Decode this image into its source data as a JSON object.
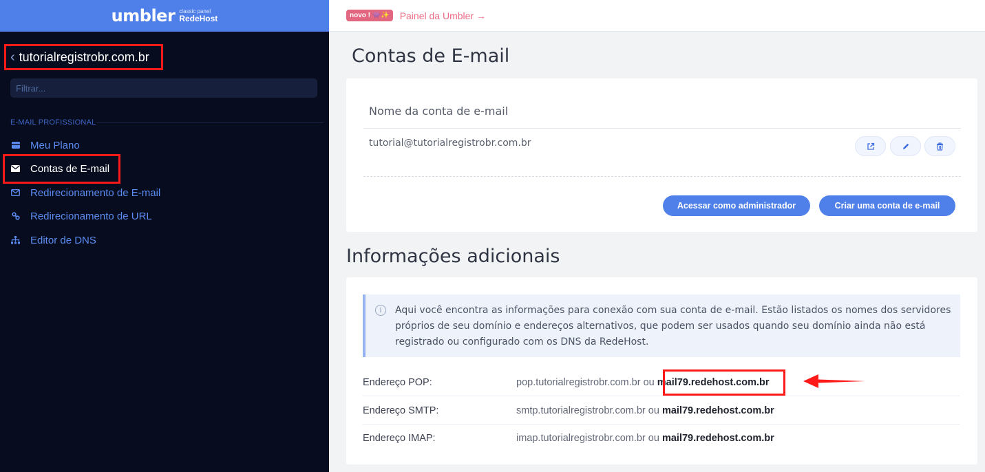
{
  "brand": {
    "logo": "umbler",
    "classic": "classic panel",
    "redehost": "RedeHost"
  },
  "sidebar": {
    "domain": "tutorialregistrobr.com.br",
    "filter_placeholder": "Filtrar...",
    "section_label": "E-MAIL PROFISSIONAL",
    "items": [
      {
        "label": "Meu Plano",
        "icon": "card-icon"
      },
      {
        "label": "Contas de E-mail",
        "icon": "envelope-icon",
        "active": true
      },
      {
        "label": "Redirecionamento de E-mail",
        "icon": "envelope-outline-icon"
      },
      {
        "label": "Redirecionamento de URL",
        "icon": "link-icon"
      },
      {
        "label": "Editor de DNS",
        "icon": "sitemap-icon"
      }
    ]
  },
  "topbar": {
    "badge": "novo ! 👾✨",
    "link": "Painel da Umbler →"
  },
  "main": {
    "title": "Contas de E-mail",
    "column_header": "Nome da conta de e-mail",
    "accounts": [
      {
        "address": "tutorial@tutorialregistrobr.com.br"
      }
    ],
    "buttons": {
      "admin": "Acessar como administrador",
      "create": "Criar uma conta de e-mail"
    }
  },
  "info": {
    "title": "Informações adicionais",
    "notice": "Aqui você encontra as informações para conexão com sua conta de e-mail. Estão listados os nomes dos servidores próprios de seu domínio e endereços alternativos, que podem ser usados quando seu domínio ainda não está registrado ou configurado com os DNS da RedeHost.",
    "rows": [
      {
        "label": "Endereço POP:",
        "value": "pop.tutorialregistrobr.com.br",
        "or": "ou",
        "alt": "mail79.redehost.com.br"
      },
      {
        "label": "Endereço SMTP:",
        "value": "smtp.tutorialregistrobr.com.br",
        "or": "ou",
        "alt": "mail79.redehost.com.br"
      },
      {
        "label": "Endereço IMAP:",
        "value": "imap.tutorialregistrobr.com.br",
        "or": "ou",
        "alt": "mail79.redehost.com.br"
      }
    ]
  },
  "colors": {
    "brand_blue": "#4f7fe8",
    "sidebar_bg": "#070d1f",
    "annotation_red": "#ff1a1a",
    "badge_pink": "#e2667f"
  }
}
